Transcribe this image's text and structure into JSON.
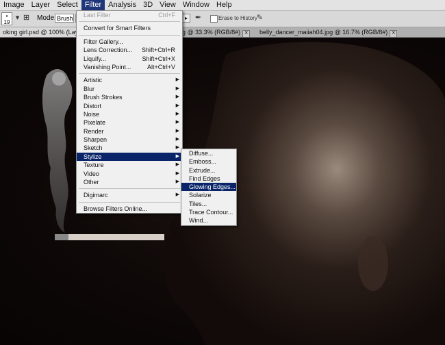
{
  "menubar": {
    "items": [
      "Image",
      "Layer",
      "Select",
      "Filter",
      "Analysis",
      "3D",
      "View",
      "Window",
      "Help"
    ],
    "active": "Filter"
  },
  "options": {
    "brush_size": "19",
    "mode_label": "Mode:",
    "mode_value": "Brush",
    "erase_to_history": "Erase to History"
  },
  "tabs": [
    {
      "label": "oking girl.psd @ 100% (Layer",
      "active": true
    },
    {
      "label": "g @ 33.3% (RGB/8#)",
      "active": false
    },
    {
      "label": "belly_dancer_maiiah04.jpg @ 16.7% (RGB/8#)",
      "active": false
    }
  ],
  "filter_menu": {
    "sections": [
      [
        {
          "label": "Last Filter",
          "shortcut": "Ctrl+F",
          "disabled": true
        }
      ],
      [
        {
          "label": "Convert for Smart Filters"
        }
      ],
      [
        {
          "label": "Filter Gallery..."
        },
        {
          "label": "Lens Correction...",
          "shortcut": "Shift+Ctrl+R"
        },
        {
          "label": "Liquify...",
          "shortcut": "Shift+Ctrl+X"
        },
        {
          "label": "Vanishing Point...",
          "shortcut": "Alt+Ctrl+V"
        }
      ],
      [
        {
          "label": "Artistic",
          "submenu": true
        },
        {
          "label": "Blur",
          "submenu": true
        },
        {
          "label": "Brush Strokes",
          "submenu": true
        },
        {
          "label": "Distort",
          "submenu": true
        },
        {
          "label": "Noise",
          "submenu": true
        },
        {
          "label": "Pixelate",
          "submenu": true
        },
        {
          "label": "Render",
          "submenu": true
        },
        {
          "label": "Sharpen",
          "submenu": true
        },
        {
          "label": "Sketch",
          "submenu": true
        },
        {
          "label": "Stylize",
          "submenu": true,
          "highlighted": true
        },
        {
          "label": "Texture",
          "submenu": true
        },
        {
          "label": "Video",
          "submenu": true
        },
        {
          "label": "Other",
          "submenu": true
        }
      ],
      [
        {
          "label": "Digimarc",
          "submenu": true
        }
      ],
      [
        {
          "label": "Browse Filters Online..."
        }
      ]
    ]
  },
  "stylize_submenu": {
    "items": [
      "Diffuse...",
      "Emboss...",
      "Extrude...",
      "Find Edges",
      "Glowing Edges...",
      "Solarize",
      "Tiles...",
      "Trace Contour...",
      "Wind..."
    ],
    "highlighted": "Glowing Edges..."
  },
  "colors": {
    "menu_highlight": "#0a246a",
    "menubar_active": "#20367a",
    "canvas_bg": "#0a0605"
  }
}
